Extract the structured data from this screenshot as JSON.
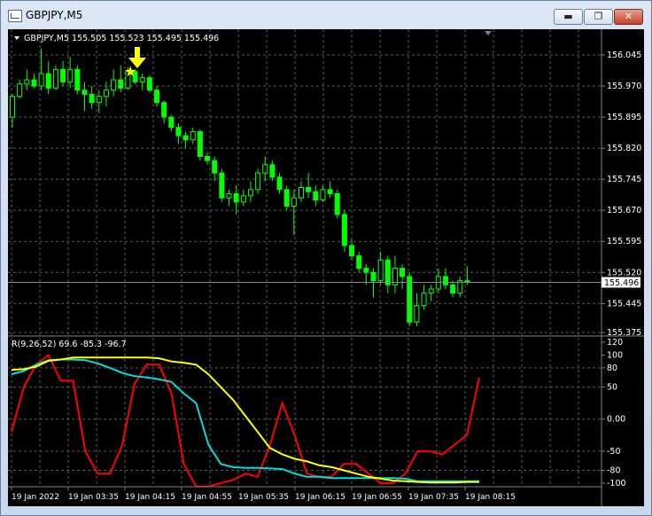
{
  "window": {
    "title": "GBPJPY,M5",
    "minimize_glyph": "▬",
    "maximize_glyph": "❐",
    "close_glyph": "✕"
  },
  "main_panel": {
    "info": "GBPJPY,M5  155.505 155.523 155.495 155.496",
    "price_ticks": [
      "156.045",
      "155.970",
      "155.895",
      "155.820",
      "155.745",
      "155.670",
      "155.595",
      "155.520",
      "155.445",
      "155.375"
    ],
    "price_range": [
      155.375,
      156.045
    ],
    "current_price": "155.496",
    "candle_color": "#00ff00",
    "arrow_color": "#ffff00",
    "star_glyph": "★"
  },
  "indicator": {
    "label": "R(9,26,52) 69.6 -85.3 -96.7",
    "ticks": [
      "120",
      "100",
      "80",
      "50",
      "0.00",
      "-50",
      "-80",
      "-100"
    ],
    "range": [
      -100,
      120
    ],
    "series": [
      {
        "color": "#ff0000",
        "values": [
          -20,
          50,
          85,
          100,
          60,
          60,
          -50,
          -85,
          -85,
          -40,
          55,
          85,
          85,
          40,
          -70,
          -105,
          -105,
          -100,
          -95,
          -85,
          -90,
          -40,
          25,
          -25,
          -85,
          -90,
          -90,
          -70,
          -70,
          -85,
          -100,
          -100,
          -85,
          -50,
          -50,
          -55,
          -40,
          -25,
          65
        ]
      },
      {
        "color": "#00dddd",
        "values": [
          70,
          75,
          85,
          92,
          93,
          93,
          92,
          87,
          80,
          72,
          67,
          65,
          62,
          58,
          40,
          25,
          -40,
          -70,
          -75,
          -76,
          -76,
          -77,
          -78,
          -85,
          -90,
          -90,
          -92,
          -92,
          -92,
          -92,
          -92,
          -92,
          -93,
          -97,
          -97,
          -97,
          -97,
          -97,
          -97
        ]
      },
      {
        "color": "#ffff00",
        "values": [
          77,
          78,
          82,
          91,
          93,
          96,
          96,
          96,
          96,
          96,
          96,
          96,
          95,
          90,
          88,
          85,
          70,
          50,
          30,
          5,
          -20,
          -45,
          -55,
          -62,
          -66,
          -72,
          -75,
          -80,
          -85,
          -90,
          -93,
          -96,
          -97,
          -98,
          -99,
          -99,
          -99,
          -98,
          -98
        ]
      }
    ]
  },
  "time_axis": [
    "19 Jan 2022",
    "19 Jan 03:35",
    "19 Jan 04:15",
    "19 Jan 04:55",
    "19 Jan 05:35",
    "19 Jan 06:15",
    "19 Jan 06:55",
    "19 Jan 07:35",
    "19 Jan 08:15"
  ],
  "chart_data": {
    "type": "candlestick",
    "symbol": "GBPJPY",
    "timeframe": "M5",
    "ylim": [
      155.375,
      156.045
    ],
    "candles": [
      {
        "o": 155.895,
        "h": 155.95,
        "l": 155.87,
        "c": 155.945
      },
      {
        "o": 155.945,
        "h": 155.985,
        "l": 155.94,
        "c": 155.975
      },
      {
        "o": 155.975,
        "h": 156.01,
        "l": 155.96,
        "c": 155.985
      },
      {
        "o": 155.985,
        "h": 156.0,
        "l": 155.965,
        "c": 155.97
      },
      {
        "o": 155.97,
        "h": 156.06,
        "l": 155.96,
        "c": 156.0
      },
      {
        "o": 156.0,
        "h": 156.03,
        "l": 155.95,
        "c": 155.965
      },
      {
        "o": 155.965,
        "h": 156.02,
        "l": 155.96,
        "c": 156.01
      },
      {
        "o": 156.01,
        "h": 156.03,
        "l": 155.97,
        "c": 155.98
      },
      {
        "o": 155.98,
        "h": 156.04,
        "l": 155.965,
        "c": 156.01
      },
      {
        "o": 156.01,
        "h": 156.02,
        "l": 155.95,
        "c": 155.96
      },
      {
        "o": 155.96,
        "h": 155.98,
        "l": 155.91,
        "c": 155.95
      },
      {
        "o": 155.95,
        "h": 155.97,
        "l": 155.915,
        "c": 155.93
      },
      {
        "o": 155.93,
        "h": 155.96,
        "l": 155.905,
        "c": 155.945
      },
      {
        "o": 155.945,
        "h": 155.98,
        "l": 155.92,
        "c": 155.96
      },
      {
        "o": 155.96,
        "h": 156.01,
        "l": 155.945,
        "c": 155.985
      },
      {
        "o": 155.985,
        "h": 156.02,
        "l": 155.955,
        "c": 155.965
      },
      {
        "o": 155.965,
        "h": 156.015,
        "l": 155.96,
        "c": 156.005
      },
      {
        "o": 156.005,
        "h": 156.01,
        "l": 155.975,
        "c": 155.98
      },
      {
        "o": 155.98,
        "h": 156.0,
        "l": 155.96,
        "c": 155.99
      },
      {
        "o": 155.99,
        "h": 155.995,
        "l": 155.955,
        "c": 155.96
      },
      {
        "o": 155.96,
        "h": 155.97,
        "l": 155.92,
        "c": 155.93
      },
      {
        "o": 155.93,
        "h": 155.935,
        "l": 155.88,
        "c": 155.895
      },
      {
        "o": 155.895,
        "h": 155.9,
        "l": 155.86,
        "c": 155.87
      },
      {
        "o": 155.87,
        "h": 155.88,
        "l": 155.83,
        "c": 155.85
      },
      {
        "o": 155.85,
        "h": 155.86,
        "l": 155.82,
        "c": 155.84
      },
      {
        "o": 155.84,
        "h": 155.87,
        "l": 155.83,
        "c": 155.86
      },
      {
        "o": 155.86,
        "h": 155.865,
        "l": 155.79,
        "c": 155.8
      },
      {
        "o": 155.8,
        "h": 155.81,
        "l": 155.78,
        "c": 155.79
      },
      {
        "o": 155.79,
        "h": 155.8,
        "l": 155.74,
        "c": 155.76
      },
      {
        "o": 155.76,
        "h": 155.77,
        "l": 155.69,
        "c": 155.7
      },
      {
        "o": 155.7,
        "h": 155.72,
        "l": 155.68,
        "c": 155.71
      },
      {
        "o": 155.71,
        "h": 155.73,
        "l": 155.66,
        "c": 155.69
      },
      {
        "o": 155.69,
        "h": 155.72,
        "l": 155.68,
        "c": 155.705
      },
      {
        "o": 155.705,
        "h": 155.74,
        "l": 155.69,
        "c": 155.72
      },
      {
        "o": 155.72,
        "h": 155.77,
        "l": 155.71,
        "c": 155.76
      },
      {
        "o": 155.76,
        "h": 155.8,
        "l": 155.74,
        "c": 155.78
      },
      {
        "o": 155.78,
        "h": 155.79,
        "l": 155.74,
        "c": 155.75
      },
      {
        "o": 155.75,
        "h": 155.76,
        "l": 155.71,
        "c": 155.72
      },
      {
        "o": 155.72,
        "h": 155.73,
        "l": 155.67,
        "c": 155.68
      },
      {
        "o": 155.68,
        "h": 155.72,
        "l": 155.61,
        "c": 155.7
      },
      {
        "o": 155.7,
        "h": 155.74,
        "l": 155.69,
        "c": 155.725
      },
      {
        "o": 155.725,
        "h": 155.76,
        "l": 155.7,
        "c": 155.715
      },
      {
        "o": 155.715,
        "h": 155.73,
        "l": 155.68,
        "c": 155.695
      },
      {
        "o": 155.695,
        "h": 155.73,
        "l": 155.69,
        "c": 155.72
      },
      {
        "o": 155.72,
        "h": 155.74,
        "l": 155.7,
        "c": 155.71
      },
      {
        "o": 155.71,
        "h": 155.72,
        "l": 155.65,
        "c": 155.66
      },
      {
        "o": 155.66,
        "h": 155.67,
        "l": 155.57,
        "c": 155.585
      },
      {
        "o": 155.585,
        "h": 155.6,
        "l": 155.55,
        "c": 155.56
      },
      {
        "o": 155.56,
        "h": 155.57,
        "l": 155.52,
        "c": 155.53
      },
      {
        "o": 155.53,
        "h": 155.54,
        "l": 155.49,
        "c": 155.52
      },
      {
        "o": 155.52,
        "h": 155.53,
        "l": 155.46,
        "c": 155.5
      },
      {
        "o": 155.5,
        "h": 155.57,
        "l": 155.49,
        "c": 155.55
      },
      {
        "o": 155.55,
        "h": 155.56,
        "l": 155.47,
        "c": 155.49
      },
      {
        "o": 155.49,
        "h": 155.56,
        "l": 155.47,
        "c": 155.53
      },
      {
        "o": 155.53,
        "h": 155.54,
        "l": 155.48,
        "c": 155.51
      },
      {
        "o": 155.51,
        "h": 155.52,
        "l": 155.39,
        "c": 155.4
      },
      {
        "o": 155.4,
        "h": 155.47,
        "l": 155.39,
        "c": 155.44
      },
      {
        "o": 155.44,
        "h": 155.49,
        "l": 155.43,
        "c": 155.47
      },
      {
        "o": 155.47,
        "h": 155.49,
        "l": 155.45,
        "c": 155.48
      },
      {
        "o": 155.48,
        "h": 155.53,
        "l": 155.47,
        "c": 155.51
      },
      {
        "o": 155.51,
        "h": 155.53,
        "l": 155.48,
        "c": 155.49
      },
      {
        "o": 155.49,
        "h": 155.5,
        "l": 155.46,
        "c": 155.47
      },
      {
        "o": 155.47,
        "h": 155.51,
        "l": 155.46,
        "c": 155.5
      },
      {
        "o": 155.5,
        "h": 155.535,
        "l": 155.49,
        "c": 155.496
      }
    ]
  }
}
